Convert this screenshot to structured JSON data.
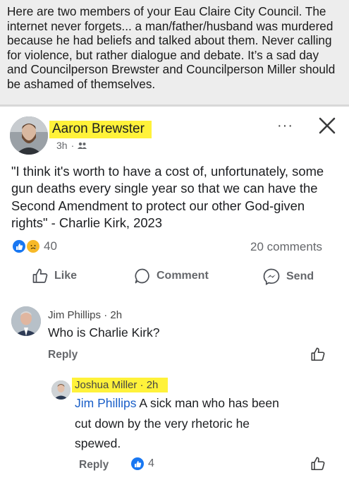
{
  "intro_text": "Here are two members of your Eau Claire City Council. The internet never forgets... a man/father/husband was murdered because he had beliefs and talked about them. Never calling for violence, but rather dialogue and debate. It’s a sad day and Councilperson Brewster and Councilperson Miller should be ashamed of themselves.",
  "post": {
    "author": "Aaron Brewster",
    "time": "3h",
    "separator": "·",
    "more_label": "···",
    "close_label": "✕",
    "text": "\"I think it's worth to have a cost of, unfortunately, some gun deaths every single year so that we can have the Second Amendment to protect our other God-given rights\" - Charlie Kirk, 2023",
    "reaction_count": "40",
    "comments_count": "20 comments",
    "actions": {
      "like": "Like",
      "comment": "Comment",
      "send": "Send"
    }
  },
  "comments": [
    {
      "author": "Jim Phillips",
      "time": "2h",
      "separator": "·",
      "text": "Who is Charlie Kirk?",
      "reply_label": "Reply"
    }
  ],
  "reply": {
    "author": "Joshua Miller",
    "time": "2h",
    "separator": "·",
    "mention": "Jim Phillips",
    "text_line1": " A sick man who has been",
    "text_line2": "cut down by the very rhetoric he",
    "text_line3": "spewed.",
    "reply_label": "Reply",
    "reaction_count": "4"
  },
  "colors": {
    "highlight": "#fff23a",
    "like_blue": "#1877f2",
    "mention_blue": "#1a5fc8",
    "muted_text": "#65676b"
  }
}
